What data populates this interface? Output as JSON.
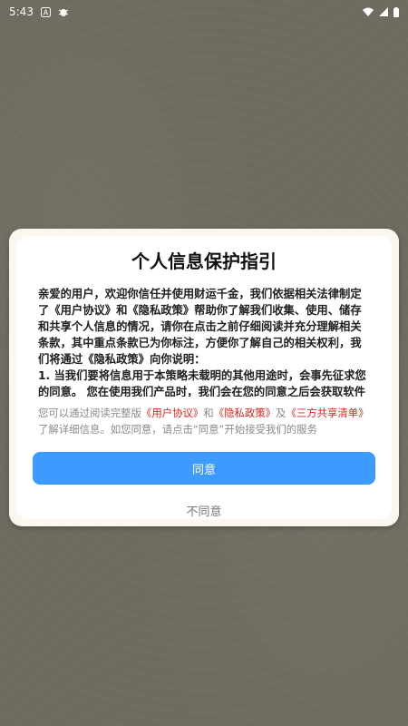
{
  "status_bar": {
    "time": "5:43",
    "icons": [
      "notification-a-icon",
      "notification-bug-icon",
      "wifi-icon",
      "cellular-signal-icon",
      "battery-icon"
    ]
  },
  "dialog": {
    "title": "个人信息保护指引",
    "policy_text": "亲爱的用户，欢迎你信任并使用财运千金，我们依据相关法律制定了《用户协议》和《隐私政策》帮助你了解我们收集、使用、储存和共享个人信息的情况，请你在点击之前仔细阅读并充分理解相关条款，其中重点条款已为你标注，方便你了解自己的相关权利，我们将通过《隐私政策》向你说明：\n1. 当我们要将信息用于本策略未载明的其他用途时，会事先征求您的同意。 您在使用我们产品时，我们会在您的同意之后会获取软件安装列表用以反作弊处理，获取OAID、Mac地址、DeviceId、IMEI、IMSI、",
    "agreement": {
      "prefix": "您可以通过阅读完整版",
      "user_agreement": "《用户协议》",
      "and": "和",
      "privacy_policy": "《隐私政策》",
      "and2": "及",
      "third_party_list": "《三方共享清单》",
      "suffix": "了解详细信息。如您同意，请点击“同意”开始接受我们的服务"
    },
    "agree_label": "同意",
    "disagree_label": "不同意"
  },
  "colors": {
    "accent": "#3d9bff",
    "link": "#e02020",
    "overlay": "#6f6a5f"
  }
}
